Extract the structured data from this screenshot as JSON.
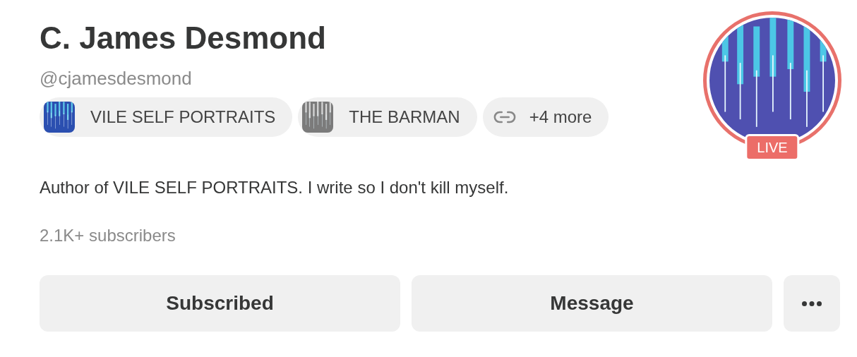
{
  "profile": {
    "name": "C. James Desmond",
    "handle": "@cjamesdesmond",
    "live": true,
    "live_label": "LIVE"
  },
  "chips": [
    {
      "kind": "publication",
      "label": "VILE SELF PORTRAITS"
    },
    {
      "kind": "publication",
      "label": "THE BARMAN"
    },
    {
      "kind": "links",
      "label": "+4 more"
    }
  ],
  "bio": "Author of VILE SELF PORTRAITS. I write so I don't kill myself.",
  "subscribers": "2.1K+ subscribers",
  "buttons": [
    {
      "kind": "text",
      "label": "Subscribed"
    },
    {
      "kind": "text",
      "label": "Message"
    },
    {
      "kind": "more"
    }
  ]
}
